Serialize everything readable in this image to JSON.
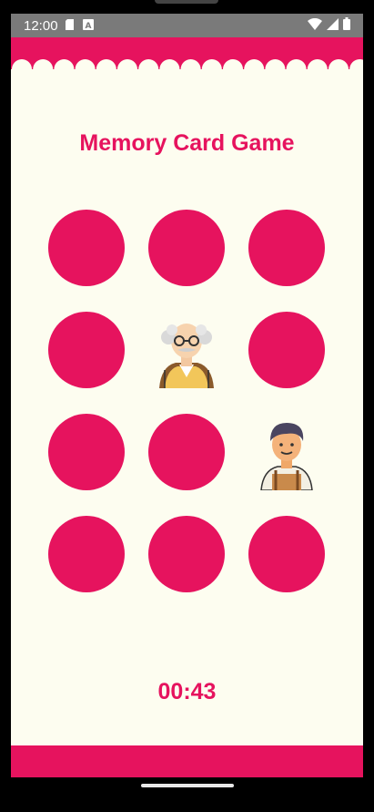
{
  "status_bar": {
    "time": "12:00",
    "icons_left": [
      "sd-card-icon",
      "a-badge-icon"
    ],
    "icons_right": [
      "wifi-icon",
      "signal-icon",
      "battery-icon"
    ]
  },
  "app": {
    "title": "Memory Card Game",
    "timer": "00:43",
    "accent_color": "#e6135e",
    "background_color": "#fdfdf0"
  },
  "grid": {
    "rows": 4,
    "cols": 3,
    "cards": [
      {
        "state": "hidden"
      },
      {
        "state": "hidden"
      },
      {
        "state": "hidden"
      },
      {
        "state": "hidden"
      },
      {
        "state": "revealed",
        "icon": "old-man-icon"
      },
      {
        "state": "hidden"
      },
      {
        "state": "hidden"
      },
      {
        "state": "hidden"
      },
      {
        "state": "revealed",
        "icon": "young-man-icon"
      },
      {
        "state": "hidden"
      },
      {
        "state": "hidden"
      },
      {
        "state": "hidden"
      }
    ]
  }
}
